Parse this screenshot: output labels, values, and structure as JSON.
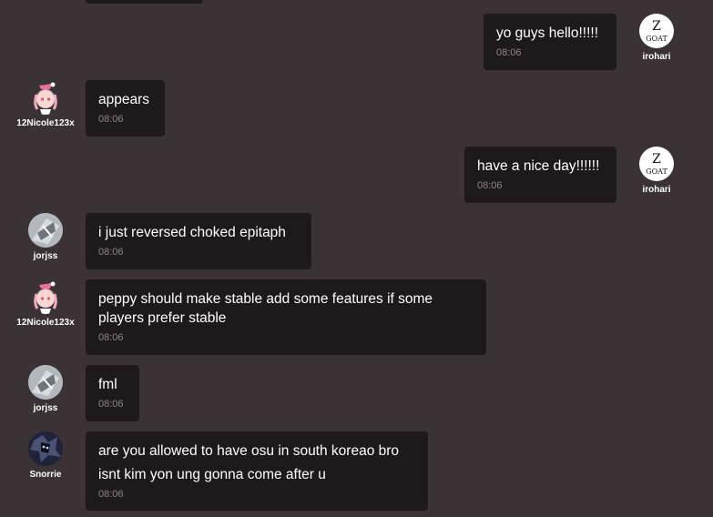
{
  "messages": [
    {
      "user": "",
      "text": "",
      "time": ""
    },
    {
      "user": "irohari",
      "text": "yo guys hello!!!!!",
      "time": "08:06",
      "avatar_icon": "goat-icon"
    },
    {
      "user": "12Nicole123x",
      "text": "appears",
      "time": "08:06",
      "avatar_icon": "anime-girl-avatar"
    },
    {
      "user": "irohari",
      "text": "have a nice day!!!!!!",
      "time": "08:06",
      "avatar_icon": "goat-icon"
    },
    {
      "user": "jorjss",
      "text": "i just reversed choked epitaph",
      "time": "08:06",
      "avatar_icon": "gray-character-avatar"
    },
    {
      "user": "12Nicole123x",
      "text": "peppy should make stable add some features if some\nplayers prefer stable",
      "time": "08:06",
      "avatar_icon": "anime-girl-avatar"
    },
    {
      "user": "jorjss",
      "text": "fml",
      "time": "08:06",
      "avatar_icon": "gray-character-avatar"
    },
    {
      "user": "Snorrie",
      "text": "are you allowed to have osu in south koreao bro\nisnt kim yon ung gonna come after u",
      "time": "08:06",
      "avatar_icon": "dark-character-avatar"
    }
  ],
  "goat_avatar_text": "GOAT",
  "goat_avatar_letter": "Z",
  "colors": {
    "background": "#3a3234",
    "bubble": "#1e1a1b",
    "text": "#ffffff",
    "timestamp": "#8f8589"
  }
}
